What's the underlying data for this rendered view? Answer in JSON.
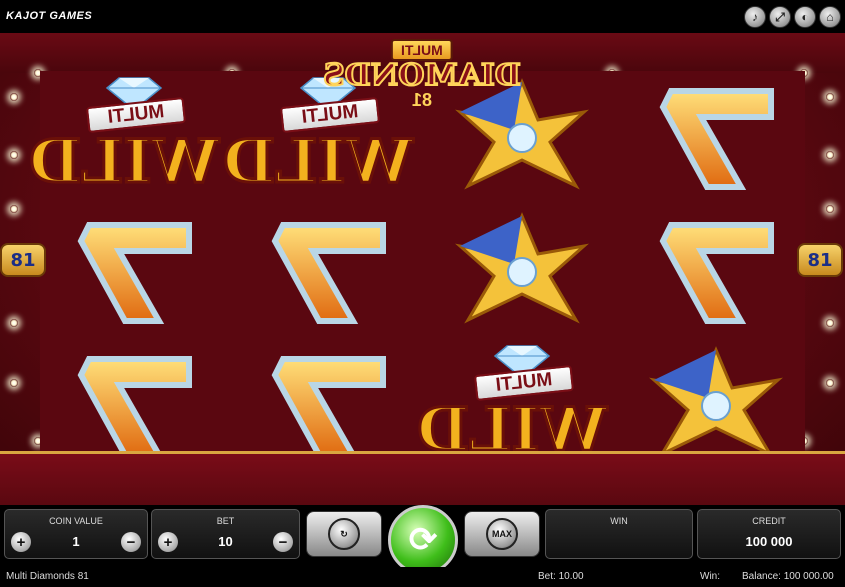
{
  "topbar": {
    "brand": "KAJOT GAMES",
    "icons": [
      "sound-icon",
      "fullscreen-icon",
      "info-icon",
      "home-icon"
    ]
  },
  "game": {
    "logo": {
      "line1": "MULTI",
      "line2": "DIAMONDS",
      "line3": "81"
    },
    "lines_left": "81",
    "lines_right": "81",
    "reels": [
      [
        "seven",
        "seven",
        "star"
      ],
      [
        "star",
        "star",
        "wild"
      ],
      [
        "wild",
        "seven",
        "seven"
      ],
      [
        "wild",
        "seven",
        "seven"
      ]
    ],
    "wild_text": {
      "multi": "MULTI",
      "word": "WILD"
    }
  },
  "controls": {
    "credit_label": "CREDIT",
    "credit_value": "100 000",
    "win_label": "WIN",
    "win_value": "",
    "bet_label": "BET",
    "bet_value": "10",
    "coin_value_label": "COIN VALUE",
    "coin_value": "1",
    "max_label": "MAX"
  },
  "status": {
    "balance": "Balance: 100 000.00",
    "win": "Win:",
    "bet": "Bet: 10.00",
    "game_name": "Multi Diamonds 81"
  }
}
